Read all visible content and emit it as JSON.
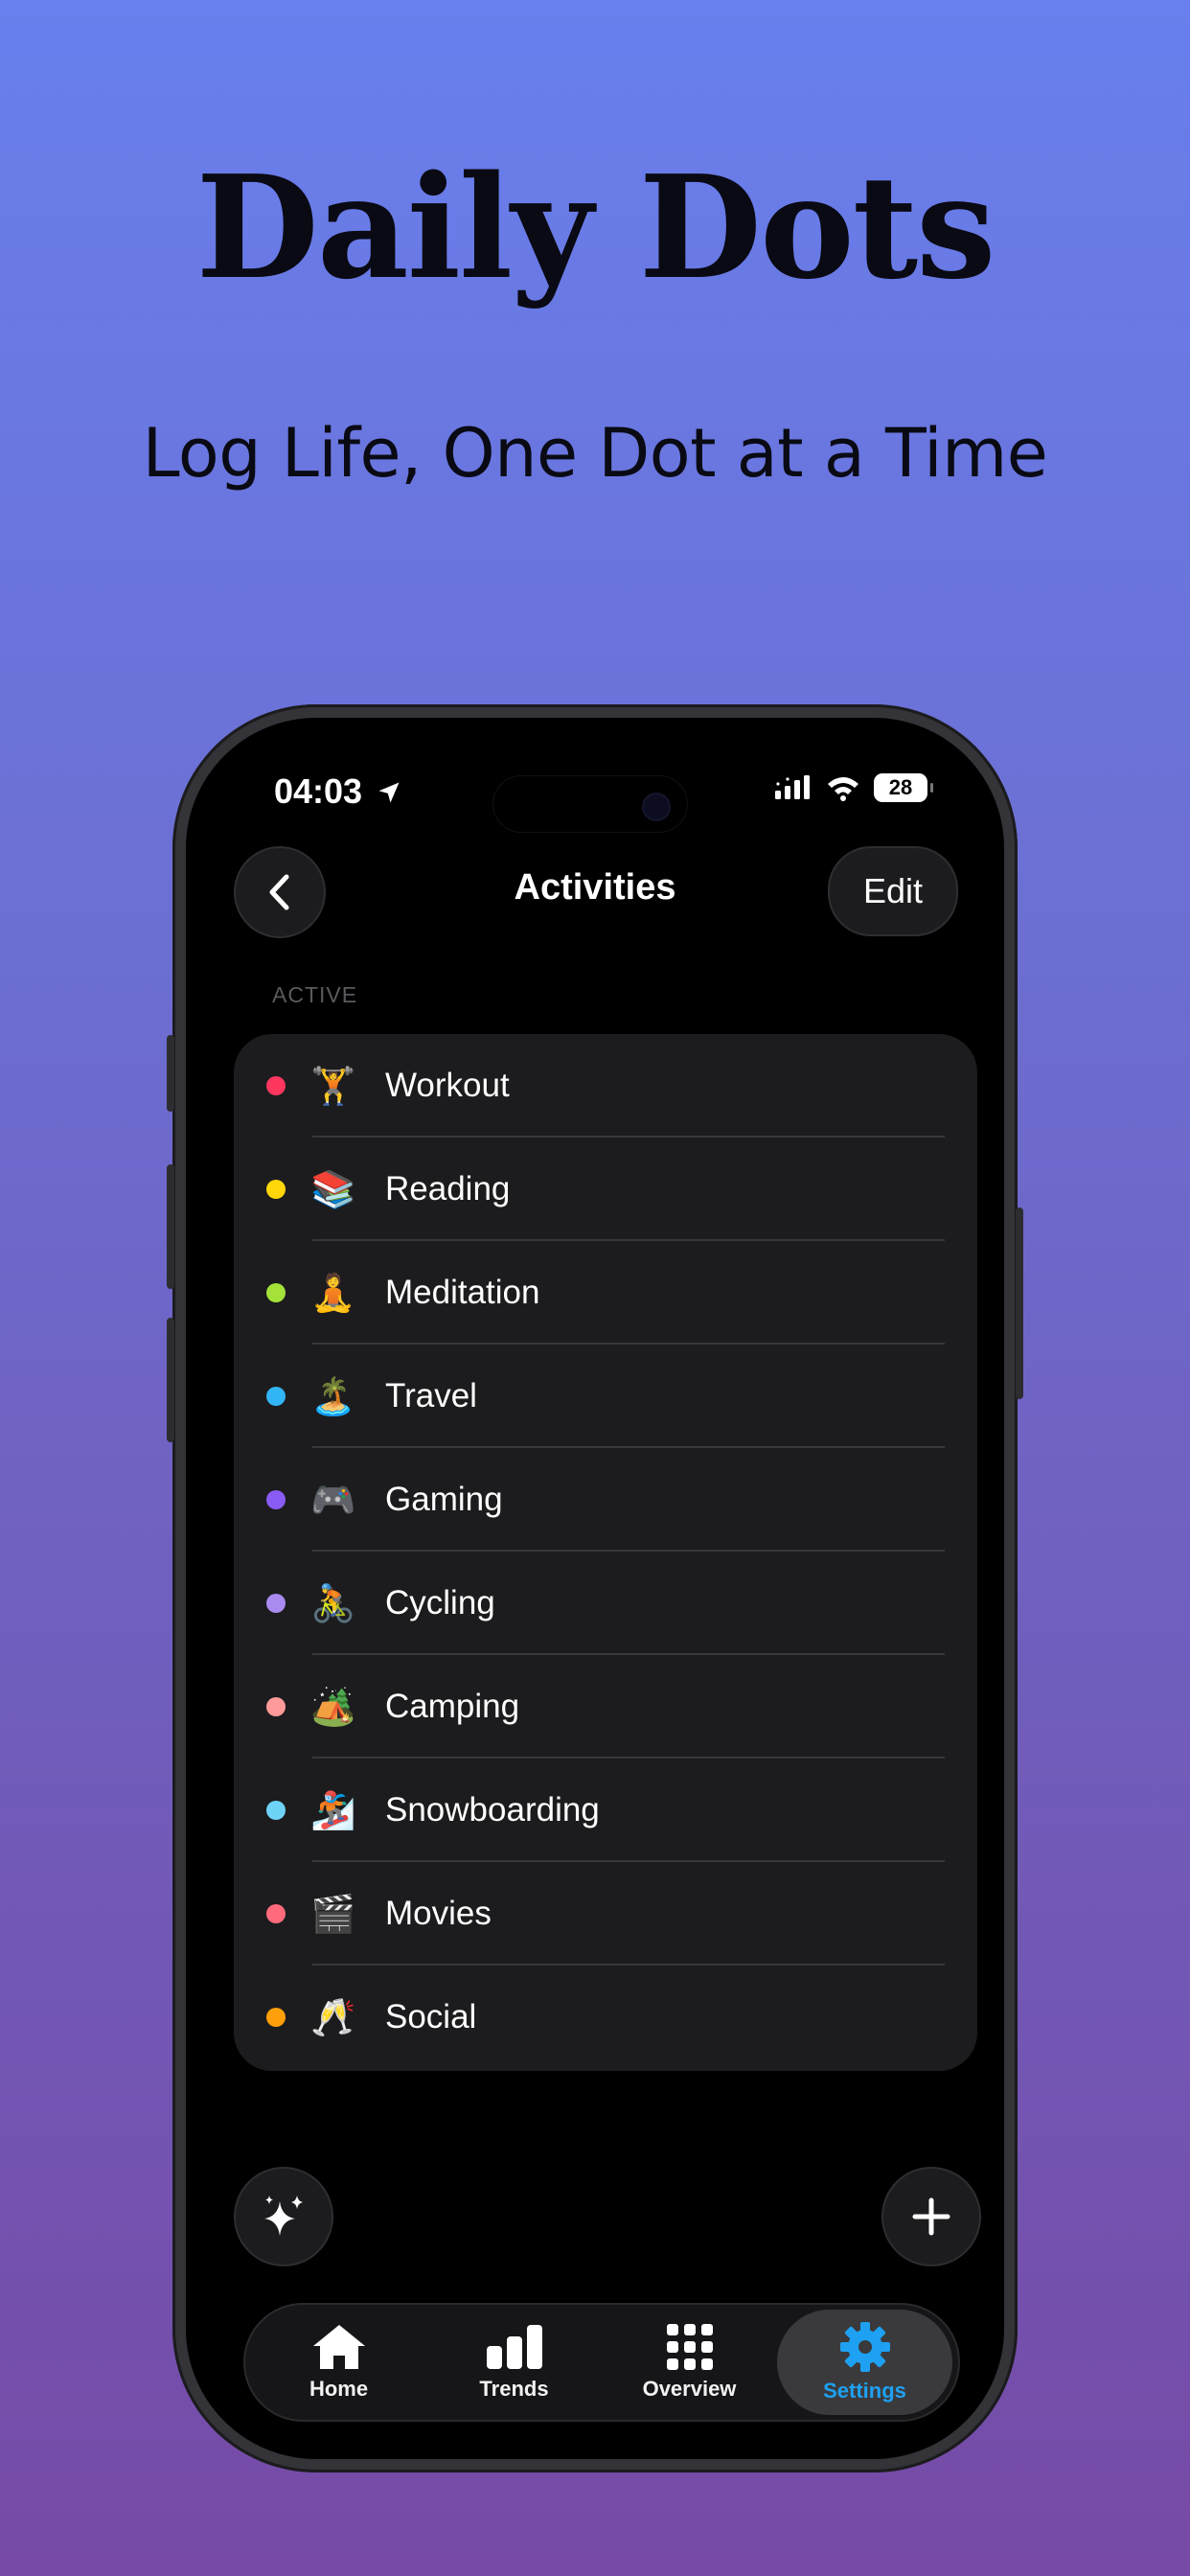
{
  "marketing": {
    "headline": "Daily Dots",
    "subheadline": "Log Life, One Dot at a Time"
  },
  "status_bar": {
    "time": "04:03",
    "battery": "28",
    "icons": [
      "location-arrow-icon",
      "signal-icon",
      "wifi-icon",
      "battery-icon"
    ]
  },
  "nav": {
    "title": "Activities",
    "back_icon": "chevron-left-icon",
    "edit_label": "Edit"
  },
  "section": {
    "label": "ACTIVE"
  },
  "activities": [
    {
      "name": "Workout",
      "emoji": "🏋️",
      "color": "#ff375f"
    },
    {
      "name": "Reading",
      "emoji": "📚",
      "color": "#ffd60a"
    },
    {
      "name": "Meditation",
      "emoji": "🧘",
      "color": "#a4e23a"
    },
    {
      "name": "Travel",
      "emoji": "🏝️",
      "color": "#32b5f4"
    },
    {
      "name": "Gaming",
      "emoji": "🎮",
      "color": "#8a5cf6"
    },
    {
      "name": "Cycling",
      "emoji": "🚴",
      "color": "#a98bf0"
    },
    {
      "name": "Camping",
      "emoji": "🏕️",
      "color": "#ff9a9a"
    },
    {
      "name": "Snowboarding",
      "emoji": "🏂",
      "color": "#6fd3f7"
    },
    {
      "name": "Movies",
      "emoji": "🎬",
      "color": "#ff6b7d"
    },
    {
      "name": "Social",
      "emoji": "🥂",
      "color": "#ff9f0a"
    }
  ],
  "actions": {
    "sparkles_icon": "sparkles-icon",
    "add_icon": "plus-icon"
  },
  "tabbar": {
    "tabs": [
      {
        "label": "Home",
        "icon": "house-icon"
      },
      {
        "label": "Trends",
        "icon": "bar-chart-icon"
      },
      {
        "label": "Overview",
        "icon": "grid-icon"
      },
      {
        "label": "Settings",
        "icon": "gear-icon"
      }
    ],
    "active": "Settings",
    "accent_color": "#1ea1f2"
  }
}
